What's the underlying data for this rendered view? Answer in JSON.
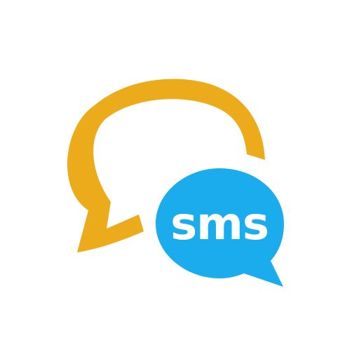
{
  "icon": {
    "name": "sms-chat-bubbles-icon",
    "label": "sms",
    "colors": {
      "background": "#ffffff",
      "outline_bubble": "#ECAB1A",
      "filled_bubble": "#1AACEC",
      "label_text": "#ffffff"
    }
  }
}
